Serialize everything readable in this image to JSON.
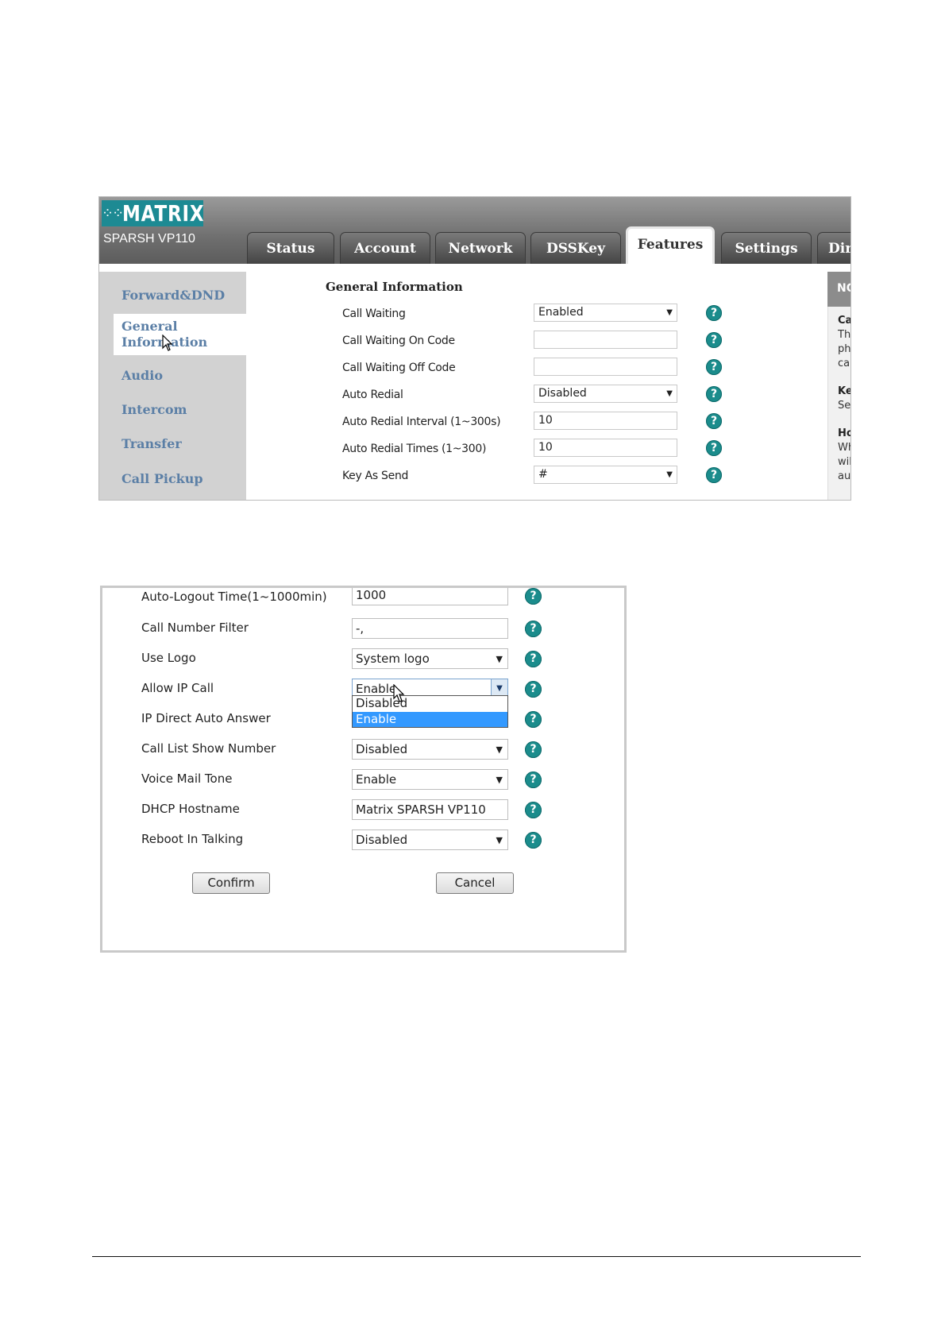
{
  "screen1": {
    "brand": "MATRIX",
    "model": "SPARSH VP110",
    "tabs": [
      {
        "label": "Status"
      },
      {
        "label": "Account"
      },
      {
        "label": "Network"
      },
      {
        "label": "DSSKey"
      },
      {
        "label": "Features",
        "active": true
      },
      {
        "label": "Settings"
      },
      {
        "label": "Dir"
      }
    ],
    "sidebar": [
      {
        "label": "Forward&DND"
      },
      {
        "label_line1": "General",
        "label_line2": "Information",
        "selected": true
      },
      {
        "label": "Audio"
      },
      {
        "label": "Intercom"
      },
      {
        "label": "Transfer"
      },
      {
        "label": "Call Pickup"
      }
    ],
    "section_title": "General Information",
    "fields": [
      {
        "label": "Call Waiting",
        "type": "select",
        "value": "Enabled"
      },
      {
        "label": "Call Waiting On Code",
        "type": "input",
        "value": ""
      },
      {
        "label": "Call Waiting Off Code",
        "type": "input",
        "value": ""
      },
      {
        "label": "Auto Redial",
        "type": "select",
        "value": "Disabled"
      },
      {
        "label": "Auto Redial Interval (1~300s)",
        "type": "input",
        "value": "10"
      },
      {
        "label": "Auto Redial Times (1~300)",
        "type": "input",
        "value": "10"
      },
      {
        "label": "Key As Send",
        "type": "select",
        "value": "#"
      }
    ],
    "note_panel": {
      "header": "NO",
      "lines": [
        "Cal",
        "Thi",
        "pho",
        "call",
        "Key",
        "Sel",
        "Ho",
        "Wh",
        "will",
        "aut"
      ]
    },
    "help_icon": "question-icon",
    "colors": {
      "brand": "#1d8a93",
      "nav_text": "#5b7fa6",
      "help": "#1b8c8c"
    }
  },
  "screen2": {
    "fields": [
      {
        "label": "Auto-Logout Time(1~1000min)",
        "type": "input",
        "value": "1000"
      },
      {
        "label": "Call Number Filter",
        "type": "input",
        "value": "-,"
      },
      {
        "label": "Use Logo",
        "type": "select",
        "value": "System logo"
      },
      {
        "label": "Allow IP Call",
        "type": "select",
        "value": "Enable",
        "open": true
      },
      {
        "label": "IP Direct Auto Answer",
        "type": "select",
        "value": ""
      },
      {
        "label": "Call List Show Number",
        "type": "select",
        "value": "Disabled"
      },
      {
        "label": "Voice Mail Tone",
        "type": "select",
        "value": "Enable"
      },
      {
        "label": "DHCP Hostname",
        "type": "input",
        "value": "Matrix SPARSH VP110"
      },
      {
        "label": "Reboot In Talking",
        "type": "select",
        "value": "Disabled"
      }
    ],
    "dropdown_options": [
      {
        "label": "Disabled",
        "highlighted": false
      },
      {
        "label": "Enable",
        "highlighted": true
      }
    ],
    "confirm_label": "Confirm",
    "cancel_label": "Cancel",
    "colors": {
      "highlight": "#3399ff"
    }
  }
}
